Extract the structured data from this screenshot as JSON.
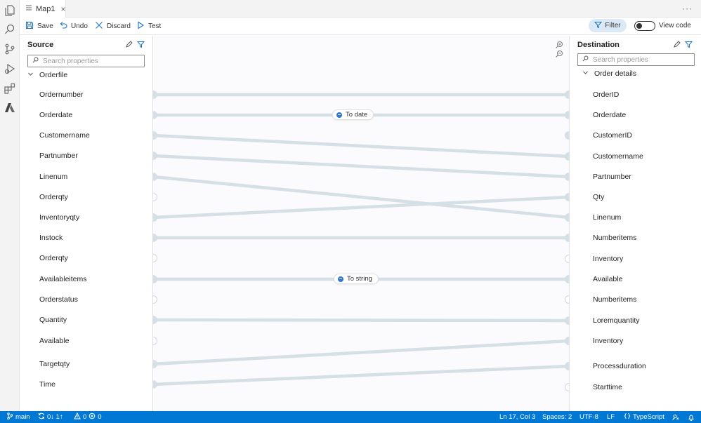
{
  "tab": {
    "title": "Map1",
    "close_glyph": "×"
  },
  "window": {
    "more_actions": "···"
  },
  "toolbar": {
    "save": "Save",
    "undo": "Undo",
    "discard": "Discard",
    "test": "Test",
    "filter": "Filter",
    "view_code": "View code",
    "view_code_enabled": false
  },
  "source": {
    "title": "Source",
    "search_placeholder": "Search properties",
    "group": "Orderfile",
    "items": [
      {
        "label": "Ordernumber",
        "mapped": true
      },
      {
        "label": "Orderdate",
        "mapped": true
      },
      {
        "label": "Customername",
        "mapped": true
      },
      {
        "label": "Partnumber",
        "mapped": true
      },
      {
        "label": "Linenum",
        "mapped": true
      },
      {
        "label": "Orderqty",
        "mapped": false
      },
      {
        "label": "Inventoryqty",
        "mapped": true
      },
      {
        "label": "Instock",
        "mapped": true
      },
      {
        "label": "Orderqty",
        "mapped": false
      },
      {
        "label": "Availableitems",
        "mapped": true
      },
      {
        "label": "Orderstatus",
        "mapped": false
      },
      {
        "label": "Quantity",
        "mapped": true
      },
      {
        "label": "Available",
        "mapped": false
      },
      {
        "label": "Targetqty",
        "mapped": true
      },
      {
        "label": "Time",
        "mapped": true
      }
    ]
  },
  "destination": {
    "title": "Destination",
    "search_placeholder": "Search properties",
    "group": "Order details",
    "items": [
      {
        "label": "OrderID",
        "mapped": true
      },
      {
        "label": "Orderdate",
        "mapped": true
      },
      {
        "label": "CustomerID",
        "mapped": true
      },
      {
        "label": "Customername",
        "mapped": true
      },
      {
        "label": "Partnumber",
        "mapped": true
      },
      {
        "label": "Qty",
        "mapped": true
      },
      {
        "label": "Linenum",
        "mapped": true
      },
      {
        "label": "Numberitems",
        "mapped": true
      },
      {
        "label": "Inventory",
        "mapped": false
      },
      {
        "label": "Available",
        "mapped": true
      },
      {
        "label": "Numberitems",
        "mapped": false
      },
      {
        "label": "Loremquantity",
        "mapped": true
      },
      {
        "label": "Inventory",
        "mapped": true
      },
      {
        "label": "Processduration",
        "mapped": true
      },
      {
        "label": "Starttime",
        "mapped": false
      }
    ]
  },
  "mappings": [
    {
      "from": 0,
      "to": 0
    },
    {
      "from": 1,
      "to": 1,
      "function": "To date"
    },
    {
      "from": 2,
      "to": 3
    },
    {
      "from": 3,
      "to": 4
    },
    {
      "from": 4,
      "to": 6
    },
    {
      "from": 6,
      "to": 5
    },
    {
      "from": 7,
      "to": 7
    },
    {
      "from": 9,
      "to": 9,
      "function": "To string"
    },
    {
      "from": 11,
      "to": 11
    },
    {
      "from": 13,
      "to": 12
    },
    {
      "from": 14,
      "to": 13
    }
  ],
  "functions": {
    "to_date": "To date",
    "to_string": "To string"
  },
  "statusbar": {
    "branch": "main",
    "sync": "0↓ 1↑",
    "warnings": "0",
    "errors": "0",
    "position": "Ln 17, Col 3",
    "spaces": "Spaces: 2",
    "encoding": "UTF-8",
    "eol": "LF",
    "language": "TypeScript"
  },
  "colors": {
    "accent": "#0078d4",
    "connector": "#d5dfe6",
    "port_filled": "#d5dfe6",
    "function_dot": "#2f77d4",
    "filter_bg": "#dbe9f6"
  }
}
